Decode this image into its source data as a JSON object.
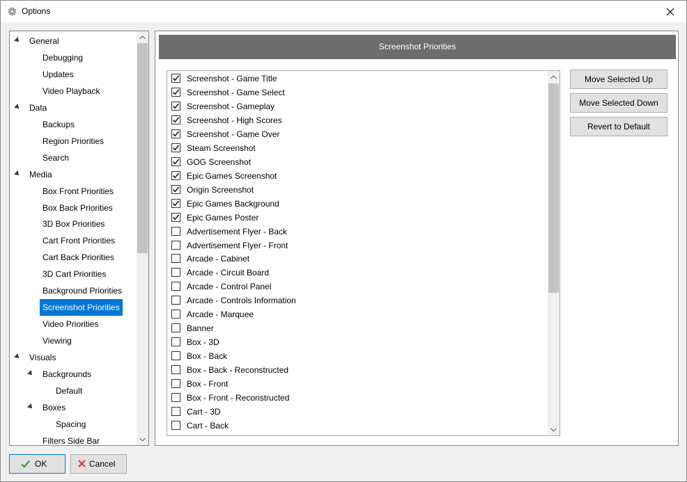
{
  "window": {
    "title": "Options",
    "app_icon": "gear-icon",
    "close_icon": "close-icon"
  },
  "tree": {
    "selected": "Screenshot Priorities",
    "items": [
      {
        "label": "General",
        "level": 0,
        "expanded": true
      },
      {
        "label": "Debugging",
        "level": 1
      },
      {
        "label": "Updates",
        "level": 1
      },
      {
        "label": "Video Playback",
        "level": 1
      },
      {
        "label": "Data",
        "level": 0,
        "expanded": true
      },
      {
        "label": "Backups",
        "level": 1
      },
      {
        "label": "Region Priorities",
        "level": 1
      },
      {
        "label": "Search",
        "level": 1
      },
      {
        "label": "Media",
        "level": 0,
        "expanded": true
      },
      {
        "label": "Box Front Priorities",
        "level": 1
      },
      {
        "label": "Box Back Priorities",
        "level": 1
      },
      {
        "label": "3D Box Priorities",
        "level": 1
      },
      {
        "label": "Cart Front Priorities",
        "level": 1
      },
      {
        "label": "Cart Back Priorities",
        "level": 1
      },
      {
        "label": "3D Cart Priorities",
        "level": 1
      },
      {
        "label": "Background Priorities",
        "level": 1
      },
      {
        "label": "Screenshot Priorities",
        "level": 1
      },
      {
        "label": "Video Priorities",
        "level": 1
      },
      {
        "label": "Viewing",
        "level": 1
      },
      {
        "label": "Visuals",
        "level": 0,
        "expanded": true
      },
      {
        "label": "Backgrounds",
        "level": 1,
        "expanded": true
      },
      {
        "label": "Default",
        "level": 2
      },
      {
        "label": "Boxes",
        "level": 1,
        "expanded": true
      },
      {
        "label": "Spacing",
        "level": 2
      },
      {
        "label": "Filters Side Bar",
        "level": 1
      }
    ]
  },
  "panel": {
    "header": "Screenshot Priorities",
    "items": [
      {
        "label": "Screenshot - Game Title",
        "checked": true
      },
      {
        "label": "Screenshot - Game Select",
        "checked": true
      },
      {
        "label": "Screenshot - Gameplay",
        "checked": true
      },
      {
        "label": "Screenshot - High Scores",
        "checked": true
      },
      {
        "label": "Screenshot - Game Over",
        "checked": true
      },
      {
        "label": "Steam Screenshot",
        "checked": true
      },
      {
        "label": "GOG Screenshot",
        "checked": true
      },
      {
        "label": "Epic Games Screenshot",
        "checked": true
      },
      {
        "label": "Origin Screenshot",
        "checked": true
      },
      {
        "label": "Epic Games Background",
        "checked": true
      },
      {
        "label": "Epic Games Poster",
        "checked": true
      },
      {
        "label": "Advertisement Flyer - Back",
        "checked": false
      },
      {
        "label": "Advertisement Flyer - Front",
        "checked": false
      },
      {
        "label": "Arcade - Cabinet",
        "checked": false
      },
      {
        "label": "Arcade - Circuit Board",
        "checked": false
      },
      {
        "label": "Arcade - Control Panel",
        "checked": false
      },
      {
        "label": "Arcade - Controls Information",
        "checked": false
      },
      {
        "label": "Arcade - Marquee",
        "checked": false
      },
      {
        "label": "Banner",
        "checked": false
      },
      {
        "label": "Box - 3D",
        "checked": false
      },
      {
        "label": "Box - Back",
        "checked": false
      },
      {
        "label": "Box - Back - Reconstructed",
        "checked": false
      },
      {
        "label": "Box - Front",
        "checked": false
      },
      {
        "label": "Box - Front - Reconstructed",
        "checked": false
      },
      {
        "label": "Cart - 3D",
        "checked": false
      },
      {
        "label": "Cart - Back",
        "checked": false
      }
    ],
    "buttons": {
      "move_up": "Move Selected Up",
      "move_down": "Move Selected Down",
      "revert": "Revert to Default"
    }
  },
  "footer": {
    "ok_label": "OK",
    "cancel_label": "Cancel",
    "ok_icon": "checkmark-icon",
    "cancel_icon": "cross-icon",
    "ok_icon_color": "#2e9e3e",
    "cancel_icon_color": "#d13438"
  },
  "colors": {
    "selection": "#0078d7",
    "header_bar": "#6d6d6d"
  }
}
